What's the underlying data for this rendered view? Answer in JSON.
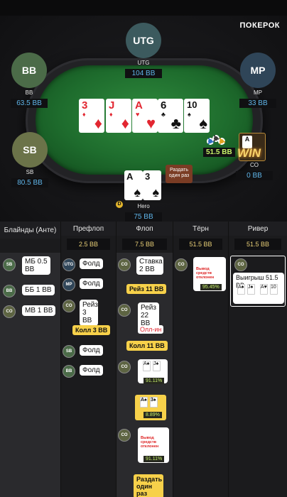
{
  "brand": "ПОКЕРОК",
  "seats": {
    "utg": {
      "avatar": "UTG",
      "name": "UTG",
      "stack": "104 BB"
    },
    "bb": {
      "avatar": "BB",
      "name": "BB",
      "stack": "63.5 BB"
    },
    "mp": {
      "avatar": "MP",
      "name": "MP",
      "stack": "33 BB"
    },
    "sb": {
      "avatar": "SB",
      "name": "SB",
      "stack": "80.5 BB"
    },
    "co": {
      "name": "CO",
      "stack": "0 BB"
    },
    "hero": {
      "name": "Hero",
      "stack": "75 BB"
    }
  },
  "board": [
    {
      "rank": "3",
      "suit": "♦",
      "color": "red"
    },
    {
      "rank": "J",
      "suit": "♦",
      "color": "red"
    },
    {
      "rank": "A",
      "suit": "♥",
      "color": "red"
    },
    {
      "rank": "6",
      "suit": "♣",
      "color": "black"
    },
    {
      "rank": "10",
      "suit": "♠",
      "color": "black"
    }
  ],
  "hero_cards": [
    {
      "rank": "A",
      "suit": "♠",
      "color": "black"
    },
    {
      "rank": "3",
      "suit": "♠",
      "color": "black"
    }
  ],
  "pot": "51.5 BB",
  "win_text": "WIN",
  "deal_once": "Раздать один раз",
  "dealer_button": "D",
  "columns": [
    {
      "title": "Блайнды (Анте)",
      "pot": ""
    },
    {
      "title": "Префлоп",
      "pot": "2.5 BB"
    },
    {
      "title": "Флоп",
      "pot": "7.5 BB"
    },
    {
      "title": "Тёрн",
      "pot": "51.5 BB"
    },
    {
      "title": "Ривер",
      "pot": "51.5 BB"
    }
  ],
  "blinds": [
    {
      "pos": "SB",
      "text": "МБ 0.5 BB"
    },
    {
      "pos": "BB",
      "text": "ББ 1 BB"
    },
    {
      "pos": "CO",
      "text": "МВ 1 BB"
    }
  ],
  "preflop": {
    "utg": {
      "pos": "UTG",
      "text": "Фолд"
    },
    "mp": {
      "pos": "MP",
      "text": "Фолд"
    },
    "co": {
      "pos": "CO",
      "text": "Рейз 3 BB"
    },
    "hero_call": "Колл 3 BB",
    "sb": {
      "pos": "SB",
      "text": "Фолд"
    },
    "bb": {
      "pos": "BB",
      "text": "Фолд"
    }
  },
  "flop": {
    "co_bet": {
      "pos": "CO",
      "text": "Ставка 2 BB"
    },
    "hero_raise": "Рейз 11 BB",
    "co_raise": {
      "pos": "CO",
      "text": "Рейз 22 BB"
    },
    "allin": "Олл-ин",
    "hero_call": "Колл 11 BB",
    "co_show": {
      "pos": "CO",
      "pct": "91.11%"
    },
    "hero_show": {
      "pct": "8.89%"
    },
    "co_eject": {
      "pos": "CO",
      "text": "Вывод средств отклонен",
      "pct": "91.11%"
    },
    "hero_deal": "Раздать один раз"
  },
  "turn": {
    "co": {
      "pos": "CO",
      "text": "Вывод средств отклонен",
      "pct": "95.45%"
    }
  },
  "river": {
    "co": {
      "pos": "CO",
      "text": "Выигрыш 51.5 BB"
    }
  },
  "colors": {
    "accent": "#f7d14a",
    "stack": "#5fb4e8",
    "pot": "#c7f26a"
  }
}
